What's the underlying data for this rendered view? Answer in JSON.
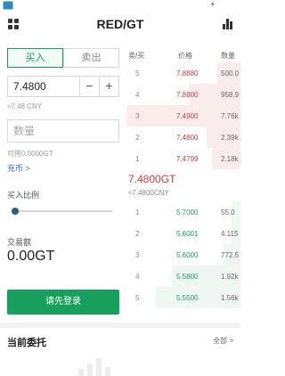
{
  "header": {
    "title": "RED/GT"
  },
  "trade": {
    "tab_buy": "买入",
    "tab_sell": "卖出",
    "price_value": "7.4800",
    "minus": "−",
    "plus": "+",
    "price_cny": "≈7.48 CNY",
    "qty_placeholder": "数量",
    "available": "可用0.0000GT",
    "recharge": "充币 >",
    "ratio_label": "买入比例",
    "ratio_value": 0,
    "amount_label": "交易额",
    "amount_value": "0.00GT",
    "login_button": "请先登录"
  },
  "orderbook": {
    "col_level": "卖/买",
    "col_price": "价格",
    "col_amount": "数量",
    "asks": [
      {
        "level": "5",
        "price": "7.8880",
        "amount": "500.0"
      },
      {
        "level": "4",
        "price": "7.8800",
        "amount": "958.9"
      },
      {
        "level": "3",
        "price": "7.4900",
        "amount": "7.76k"
      },
      {
        "level": "2",
        "price": "7.4800",
        "amount": "2.39k"
      },
      {
        "level": "1",
        "price": "7.4799",
        "amount": "2.18k"
      }
    ],
    "last_price": "7.4800GT",
    "last_price_cny": "≈7.4800CNY",
    "bids": [
      {
        "level": "1",
        "price": "5.7000",
        "amount": "55.0"
      },
      {
        "level": "2",
        "price": "5.6001",
        "amount": "4.115"
      },
      {
        "level": "3",
        "price": "5.6000",
        "amount": "772.5"
      },
      {
        "level": "4",
        "price": "5.5800",
        "amount": "1.92k"
      },
      {
        "level": "5",
        "price": "5.5500",
        "amount": "1.56k"
      }
    ]
  },
  "orders": {
    "title": "当前委托",
    "all_link": "全部 >"
  },
  "colors": {
    "buy": "#16a05c",
    "sell": "#d23b3b",
    "link": "#2d6fd1"
  },
  "icons": [
    "app-icon",
    "bolt-icon",
    "grid-icon",
    "chart-icon",
    "empty-orders-icon"
  ]
}
